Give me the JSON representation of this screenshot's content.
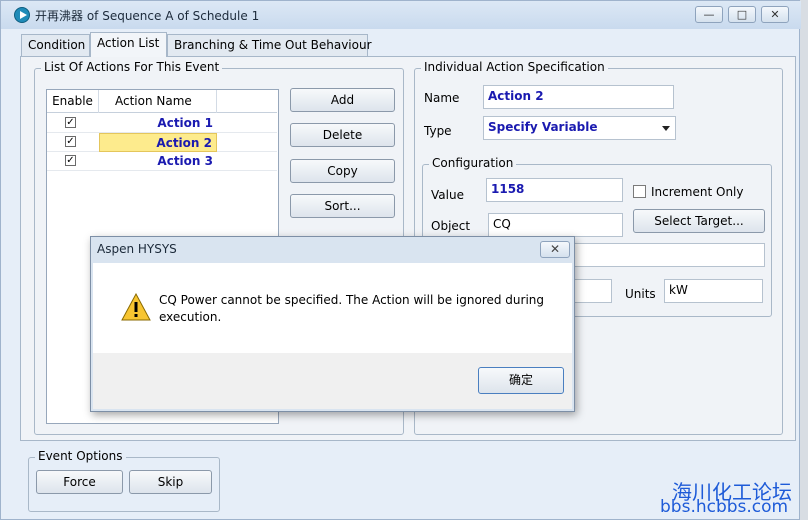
{
  "window": {
    "title": "开再沸器 of Sequence A of Schedule 1",
    "minimize_glyph": "—",
    "maximize_glyph": "□",
    "close_glyph": "✕"
  },
  "tabs": [
    {
      "label": "Condition"
    },
    {
      "label": "Action List"
    },
    {
      "label": "Branching & Time Out Behaviour"
    }
  ],
  "actions_list": {
    "title": "List Of Actions For This Event",
    "columns": [
      "Enable",
      "Action Name"
    ],
    "rows": [
      {
        "enabled": true,
        "check": "✓",
        "name": "Action 1"
      },
      {
        "enabled": true,
        "check": "✓",
        "name": "Action 2",
        "selected": true
      },
      {
        "enabled": true,
        "check": "✓",
        "name": "Action 3"
      }
    ],
    "buttons": {
      "add": "Add",
      "delete": "Delete",
      "copy": "Copy",
      "sort": "Sort..."
    }
  },
  "spec": {
    "title": "Individual Action Specification",
    "name_label": "Name",
    "name_value": "Action 2",
    "type_label": "Type",
    "type_value": "Specify Variable",
    "configuration": {
      "title": "Configuration",
      "value_label": "Value",
      "value": "1158",
      "increment_only_label": "Increment Only",
      "object_label": "Object",
      "object_value": "CQ",
      "select_target": "Select Target...",
      "units_label": "Units",
      "units_value": "kW"
    }
  },
  "event_options": {
    "title": "Event Options",
    "force": "Force",
    "skip": "Skip"
  },
  "dialog": {
    "title": "Aspen HYSYS",
    "message": "CQ Power cannot be specified. The Action will be ignored during execution.",
    "ok": "确定",
    "icon": "warning-icon"
  },
  "watermark": {
    "line1": "海川化工论坛",
    "line2": "bbs.hcbbs.com"
  }
}
